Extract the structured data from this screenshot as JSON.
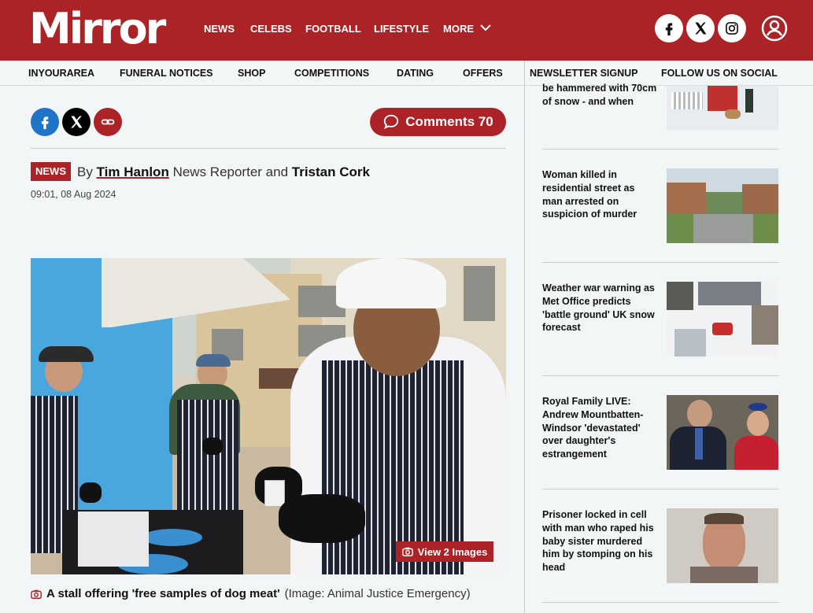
{
  "header": {
    "logo": "Mirror",
    "nav": [
      "NEWS",
      "CELEBS",
      "FOOTBALL",
      "LIFESTYLE",
      "MORE"
    ],
    "social_icons": [
      "facebook-icon",
      "x-icon",
      "instagram-icon"
    ],
    "account_icon": "account-icon",
    "bg_color": "#ab2327"
  },
  "subnav": [
    "INYOURAREA",
    "FUNERAL NOTICES",
    "SHOP",
    "COMPETITIONS",
    "DATING",
    "OFFERS",
    "NEWSLETTER SIGNUP",
    "FOLLOW US ON SOCIAL"
  ],
  "article": {
    "comments_label": "Comments 70",
    "badge": "NEWS",
    "by": "By",
    "author1": "Tim Hanlon",
    "role": "News Reporter and",
    "author2": "Tristan Cork",
    "timestamp": "09:01, 08 Aug 2024",
    "view_images": "View 2 Images",
    "caption_main": "A stall offering 'free samples of dog meat'",
    "caption_credit": "(Image: Animal Justice Emergency)"
  },
  "sidebar": {
    "items": [
      {
        "headline": "be hammered with 70cm of snow - and when"
      },
      {
        "headline": "Woman killed in residential street as man arrested on suspicion of murder"
      },
      {
        "headline": "Weather war warning as Met Office predicts 'battle ground' UK snow forecast"
      },
      {
        "headline": "Royal Family LIVE: Andrew Mountbatten-Windsor 'devastated' over daughter's estrangement"
      },
      {
        "headline": "Prisoner locked in cell with man who raped his baby sister murdered him by stomping on his head"
      }
    ]
  }
}
